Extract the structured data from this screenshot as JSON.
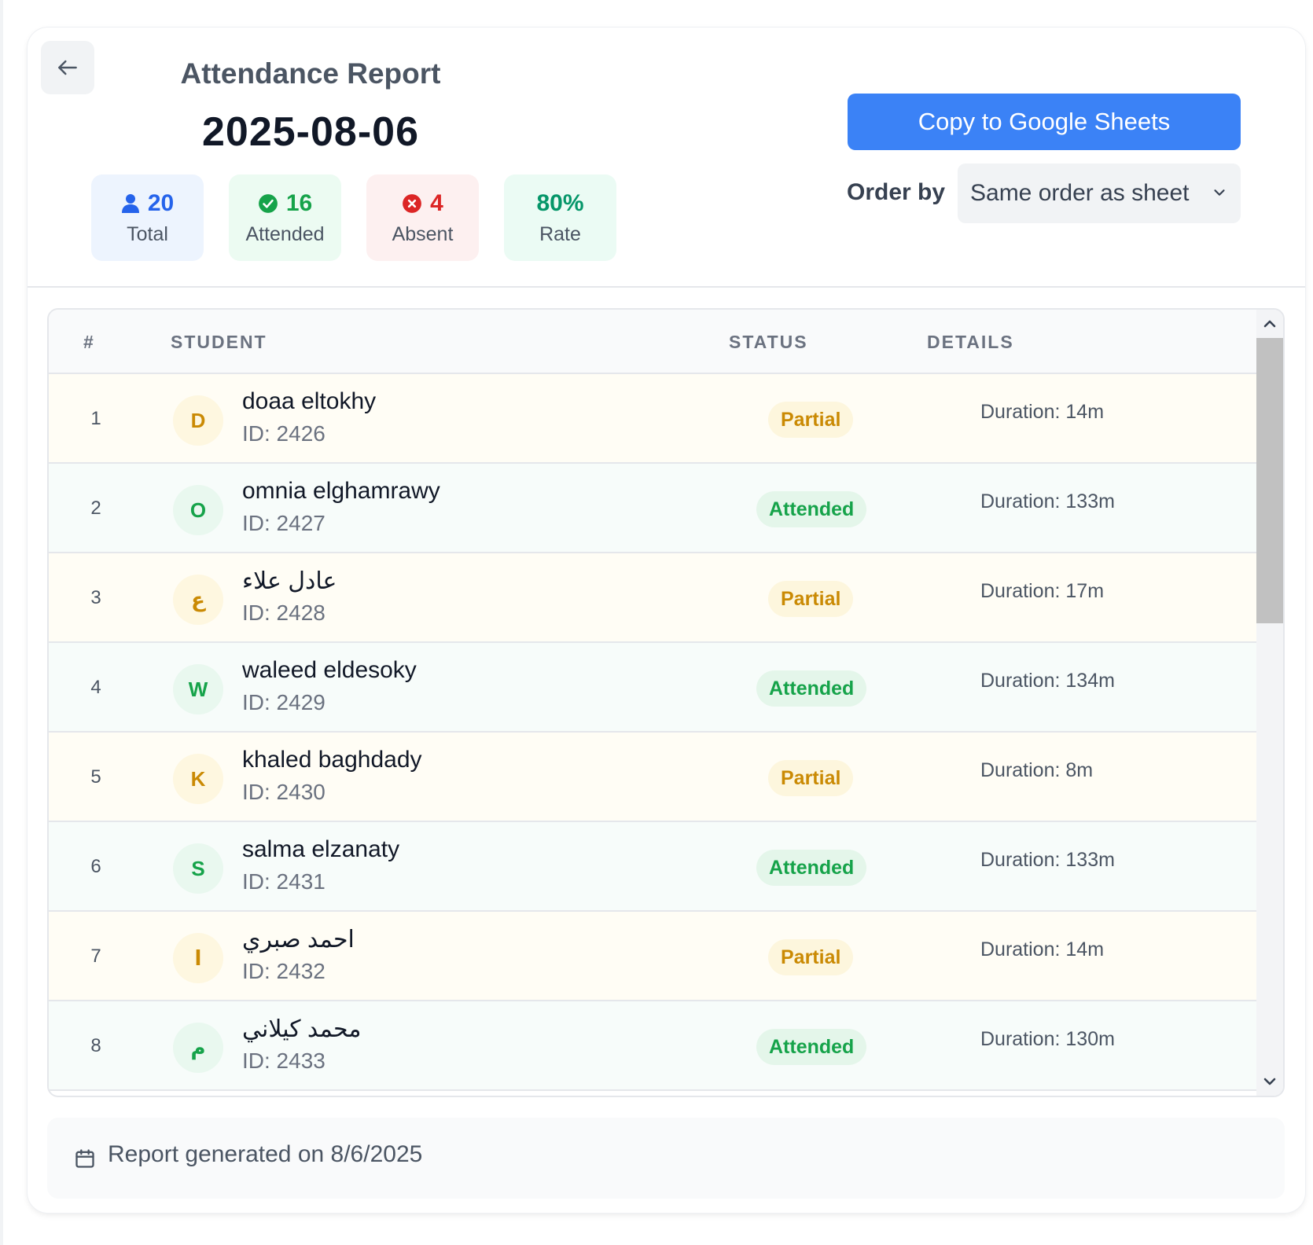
{
  "header": {
    "title": "Attendance Report",
    "date": "2025-08-06",
    "back_icon": "arrow-left-icon"
  },
  "stats": {
    "total": {
      "value": "20",
      "label": "Total",
      "icon": "user-icon",
      "color": "#2563eb"
    },
    "attended": {
      "value": "16",
      "label": "Attended",
      "icon": "check-circle-icon",
      "color": "#16a34a"
    },
    "absent": {
      "value": "4",
      "label": "Absent",
      "icon": "x-circle-icon",
      "color": "#dc2626"
    },
    "rate": {
      "value": "80%",
      "label": "Rate",
      "color": "#059669"
    }
  },
  "actions": {
    "copy_label": "Copy to Google Sheets",
    "copy_color": "#3b82f6",
    "order_label": "Order by",
    "order_selected": "Same order as sheet"
  },
  "table": {
    "columns": [
      "#",
      "STUDENT",
      "STATUS",
      "DETAILS"
    ],
    "rows": [
      {
        "num": "1",
        "initial": "D",
        "name": "doaa eltokhy",
        "id": "ID: 2426",
        "status": "Partial",
        "details": "Duration: 14m"
      },
      {
        "num": "2",
        "initial": "O",
        "name": "omnia elghamrawy",
        "id": "ID: 2427",
        "status": "Attended",
        "details": "Duration: 133m"
      },
      {
        "num": "3",
        "initial": "ع",
        "name": "عادل علاء",
        "id": "ID: 2428",
        "status": "Partial",
        "details": "Duration: 17m"
      },
      {
        "num": "4",
        "initial": "W",
        "name": "waleed eldesoky",
        "id": "ID: 2429",
        "status": "Attended",
        "details": "Duration: 134m"
      },
      {
        "num": "5",
        "initial": "K",
        "name": "khaled baghdady",
        "id": "ID: 2430",
        "status": "Partial",
        "details": "Duration: 8m"
      },
      {
        "num": "6",
        "initial": "S",
        "name": "salma elzanaty",
        "id": "ID: 2431",
        "status": "Attended",
        "details": "Duration: 133m"
      },
      {
        "num": "7",
        "initial": "ا",
        "name": "احمد صبري",
        "id": "ID: 2432",
        "status": "Partial",
        "details": "Duration: 14m"
      },
      {
        "num": "8",
        "initial": "م",
        "name": "محمد كيلاني",
        "id": "ID: 2433",
        "status": "Attended",
        "details": "Duration: 130m"
      }
    ]
  },
  "status_colors": {
    "partial": "#ca8a04",
    "attended": "#16a34a"
  },
  "footer": {
    "text": "Report generated on 8/6/2025",
    "icon": "calendar-icon"
  }
}
